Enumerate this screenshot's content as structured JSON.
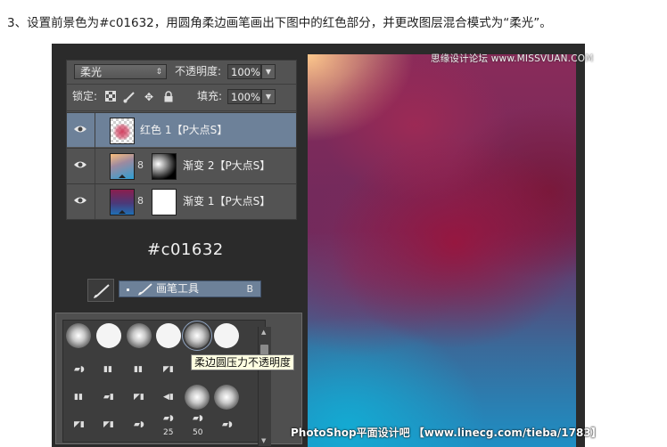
{
  "instruction": "3、设置前景色为#c01632，用圆角柔边画笔画出下图中的红色部分，并更改图层混合模式为“柔光”。",
  "layers_panel": {
    "blend_mode": "柔光",
    "opacity_label": "不透明度:",
    "opacity_value": "100%",
    "lock_label": "锁定:",
    "fill_label": "填充:",
    "fill_value": "100%",
    "layers": [
      {
        "name": "红色 1【P大点S】",
        "selected": true
      },
      {
        "name": "渐变 2【P大点S】",
        "selected": false
      },
      {
        "name": "渐变 1【P大点S】",
        "selected": false
      }
    ]
  },
  "color_label": "#c01632",
  "tool_flyout": {
    "name": "画笔工具",
    "shortcut": "B"
  },
  "brush_presets": {
    "tooltip": "柔边圆压力不透明度",
    "size_labels": [
      "25",
      "50"
    ]
  },
  "watermarks": {
    "top": "思缘设计论坛 www.MISSVUAN.COM",
    "bottom": "PhotoShop平面设计吧 【www.linecg.com/tieba/1783】"
  },
  "colors": {
    "foreground": "#c01632",
    "selected_layer": "#6d8199"
  }
}
